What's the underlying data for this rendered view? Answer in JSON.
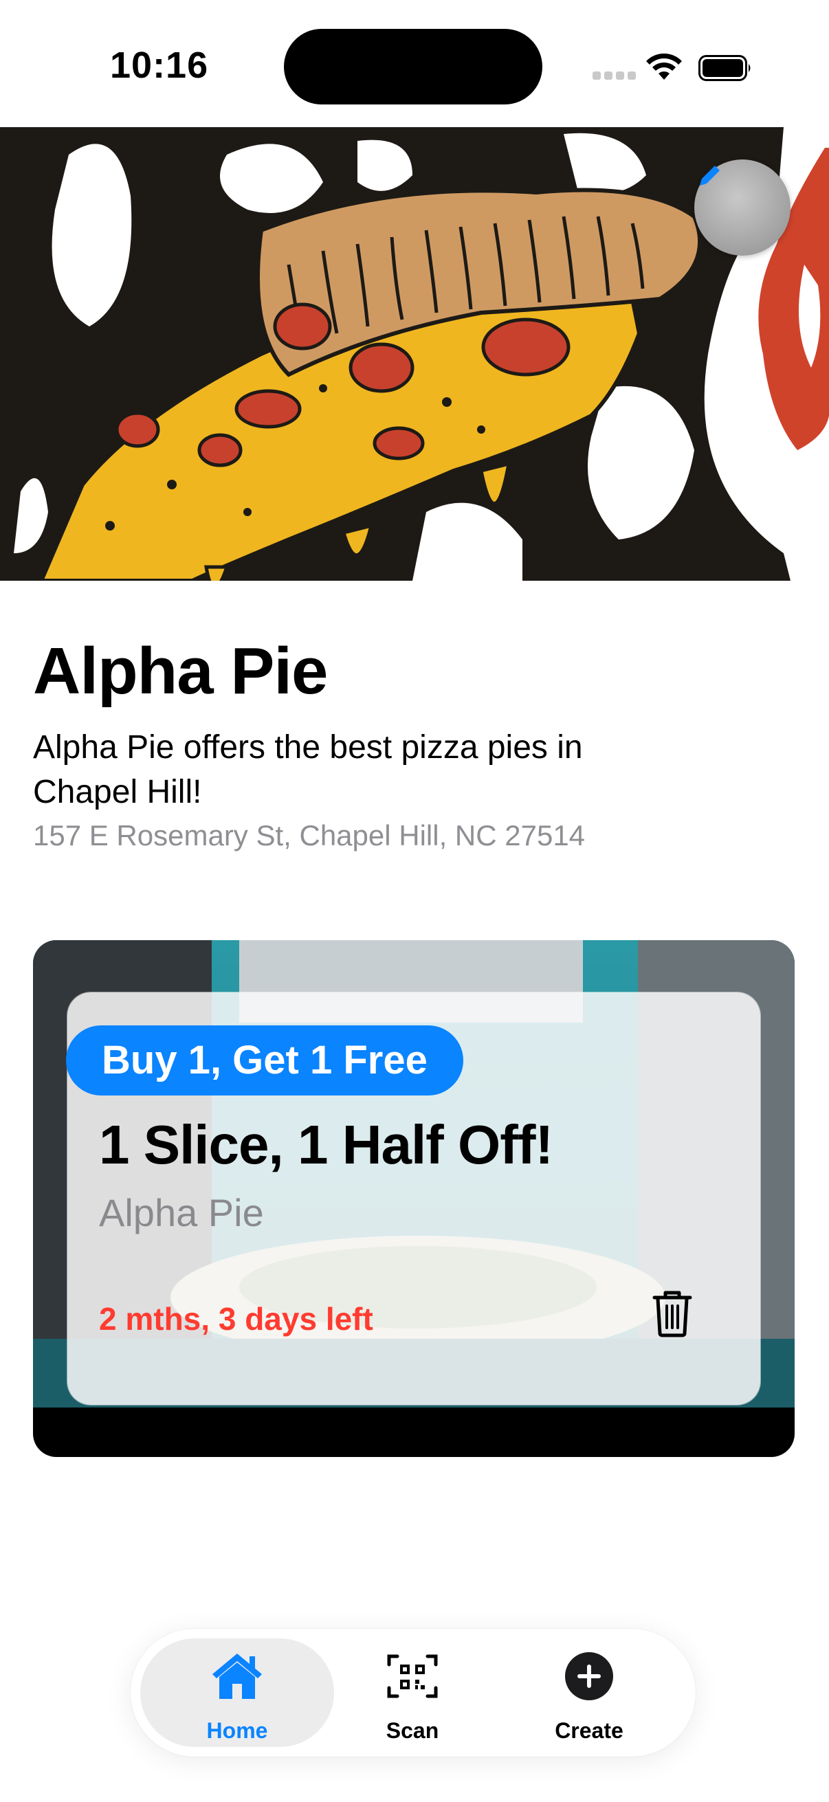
{
  "status_bar": {
    "time": "10:16"
  },
  "restaurant": {
    "name": "Alpha Pie",
    "description": "Alpha Pie offers the best pizza pies in Chapel Hill!",
    "address": "157 E Rosemary St, Chapel Hill, NC 27514"
  },
  "deal": {
    "badge": "Buy 1, Get 1 Free",
    "title": "1 Slice, 1 Half Off!",
    "vendor": "Alpha Pie",
    "time_left": "2 mths, 3 days left"
  },
  "tabs": [
    {
      "label": "Home",
      "icon": "house-icon",
      "active": true
    },
    {
      "label": "Scan",
      "icon": "qr-scan-icon",
      "active": false
    },
    {
      "label": "Create",
      "icon": "plus-circle-icon",
      "active": false
    }
  ],
  "colors": {
    "accent": "#0a84ff",
    "expiry": "#ff3b30",
    "secondary_text": "#8e8e93"
  }
}
